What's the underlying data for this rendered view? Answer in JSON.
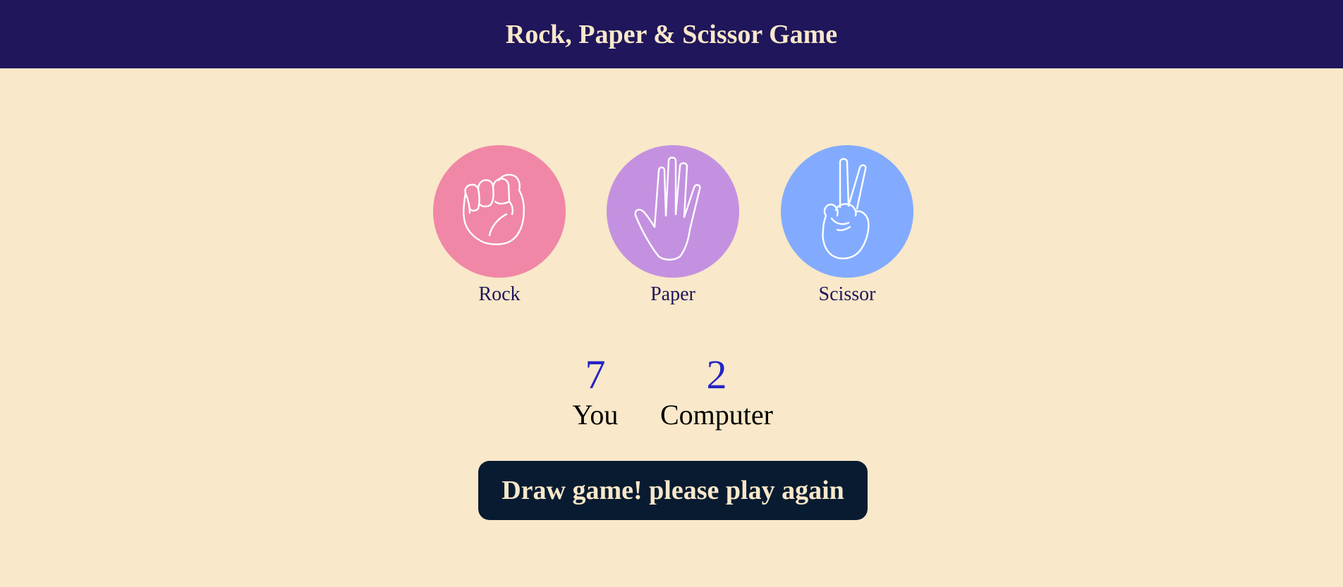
{
  "header": {
    "title": "Rock, Paper & Scissor Game"
  },
  "choices": [
    {
      "label": "Rock",
      "icon": "fist-icon",
      "color": "#f087a6"
    },
    {
      "label": "Paper",
      "icon": "open-hand-icon",
      "color": "#c491e0"
    },
    {
      "label": "Scissor",
      "icon": "peace-sign-icon",
      "color": "#82abff"
    }
  ],
  "scores": {
    "user": {
      "value": "7",
      "label": "You"
    },
    "computer": {
      "value": "2",
      "label": "Computer"
    }
  },
  "message": {
    "text": "Draw game! please play again"
  },
  "colors": {
    "background": "#f9e8c9",
    "header": "#1f165b",
    "score_number": "#2424c6",
    "message_bg": "#081b31"
  }
}
